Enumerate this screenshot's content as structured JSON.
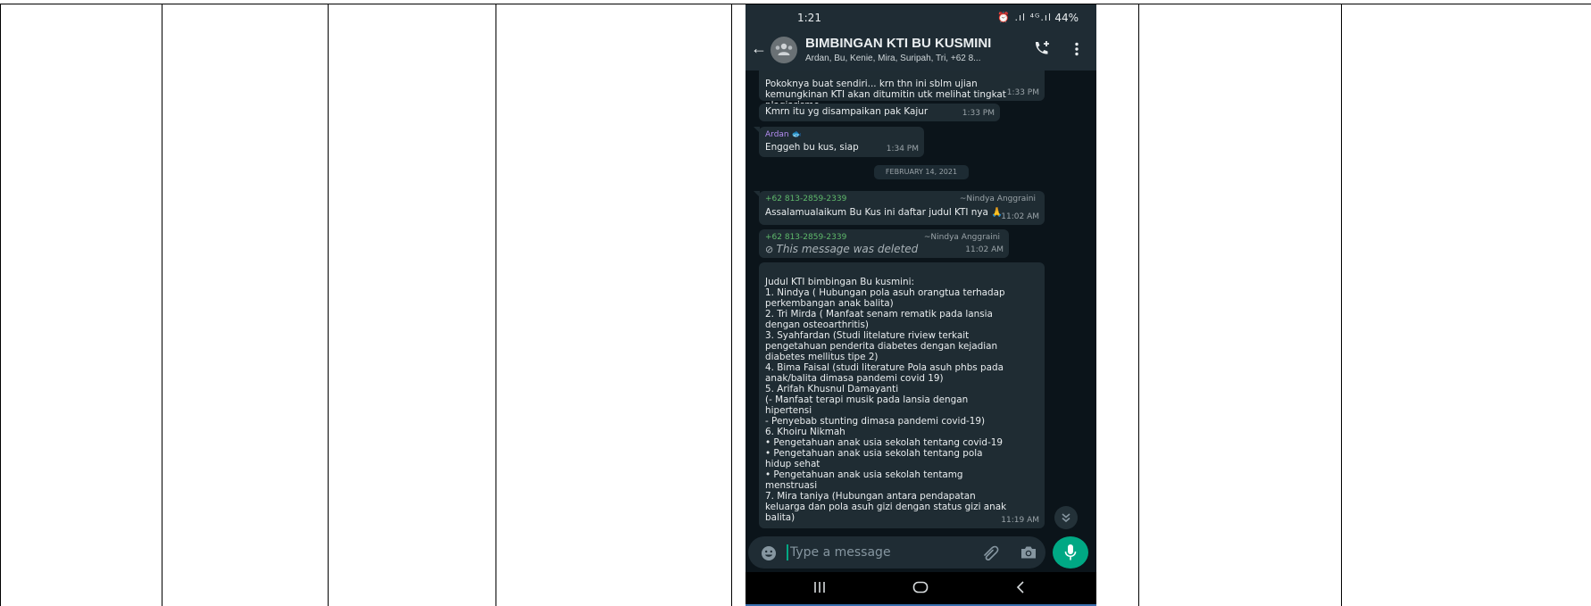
{
  "status_bar": {
    "time": "1:21",
    "icons": "⏰ .ıl ⁴ᴳ.ıl",
    "battery": "44%"
  },
  "header": {
    "title": "BIMBINGAN KTI BU KUSMINI",
    "members": "Ardan, Bu, Kenie, Mira, Suripah, Tri, +62 8..."
  },
  "messages": {
    "m1": {
      "text": "Pokoknya buat sendiri... krn thn ini sblm ujian\nkemungkinan KTI akan ditumitin utk melihat tingkat\nplagiarisme",
      "time": "1:33 PM"
    },
    "m2": {
      "text": "Kmrn itu yg disampaikan pak Kajur",
      "time": "1:33 PM"
    },
    "m3": {
      "sender": "Ardan",
      "text": "Enggeh bu kus, siap",
      "time": "1:34 PM"
    },
    "date_chip": "FEBRUARY 14, 2021",
    "m4": {
      "sender": "+62 813-2859-2339",
      "alias": "~Nindya Anggraini",
      "text": "Assalamualaikum Bu Kus ini daftar judul KTI nya 🙏",
      "time": "11:02 AM"
    },
    "m5": {
      "sender": "+62 813-2859-2339",
      "alias": "~Nindya Anggraini",
      "text": "This message was deleted",
      "time": "11:02 AM"
    },
    "m6": {
      "text": "Judul KTI bimbingan Bu kusmini:\n1. Nindya ( Hubungan pola asuh orangtua terhadap\nperkembangan anak balita)\n2. Tri Mirda ( Manfaat senam rematik pada lansia\ndengan osteoarthritis)\n3. Syahfardan (Studi litelature riview terkait\npengetahuan penderita diabetes dengan kejadian\ndiabetes mellitus tipe 2)\n4. Bima Faisal (studi literature Pola asuh phbs pada\nanak/balita dimasa pandemi covid 19)\n5. Arifah Khusnul Damayanti\n(- Manfaat terapi musik pada lansia dengan\nhipertensi\n- Penyebab stunting dimasa pandemi covid-19)\n6. Khoiru Nikmah\n • Pengetahuan anak usia sekolah tentang covid-19\n • Pengetahuan anak usia sekolah tentang pola\nhidup sehat\n • Pengetahuan anak usia sekolah tentamg\nmenstruasi\n7. Mira taniya (Hubungan antara pendapatan\nkeluarga dan pola asuh gizi dengan status gizi anak\nbalita)",
      "time": "11:19 AM"
    }
  },
  "input": {
    "placeholder": "Type a message"
  },
  "colors": {
    "background": "#0b141a",
    "header": "#1f2c34",
    "bubble": "#1f2c33",
    "accent": "#00a884",
    "sender": "#5fb96b"
  }
}
